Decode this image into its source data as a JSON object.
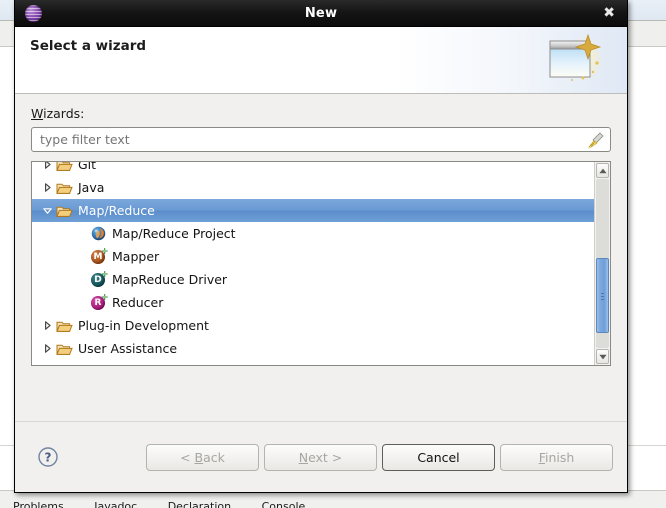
{
  "window": {
    "title": "New",
    "close_label": "✖",
    "app_icon": "eclipse-sphere-icon"
  },
  "header": {
    "title": "Select a wizard",
    "icon": "new-wizard-sparkle-icon"
  },
  "form": {
    "wizards_label_mnemonic": "W",
    "wizards_label_rest": "izards:",
    "filter_placeholder": "type filter text",
    "filter_value": "",
    "clear_filter_icon": "broom-clear-icon"
  },
  "tree": {
    "rows": [
      {
        "label": "Git",
        "level": 0,
        "expandable": true,
        "expanded": false,
        "selected": false,
        "icon": "folder-icon",
        "icon_kind": "folder"
      },
      {
        "label": "Java",
        "level": 0,
        "expandable": true,
        "expanded": false,
        "selected": false,
        "icon": "folder-icon",
        "icon_kind": "folder"
      },
      {
        "label": "Map/Reduce",
        "level": 0,
        "expandable": true,
        "expanded": true,
        "selected": true,
        "icon": "folder-icon",
        "icon_kind": "folder"
      },
      {
        "label": "Map/Reduce Project",
        "level": 1,
        "expandable": false,
        "expanded": false,
        "selected": false,
        "icon": "hadoop-elephant-icon",
        "icon_kind": "hadoop"
      },
      {
        "label": "Mapper",
        "level": 1,
        "expandable": false,
        "expanded": false,
        "selected": false,
        "icon": "mapper-m-icon",
        "icon_kind": "circle",
        "letter": "M",
        "color": "#a8521c"
      },
      {
        "label": "MapReduce Driver",
        "level": 1,
        "expandable": false,
        "expanded": false,
        "selected": false,
        "icon": "driver-d-icon",
        "icon_kind": "circle",
        "letter": "D",
        "color": "#12575c"
      },
      {
        "label": "Reducer",
        "level": 1,
        "expandable": false,
        "expanded": false,
        "selected": false,
        "icon": "reducer-r-icon",
        "icon_kind": "circle",
        "letter": "R",
        "color": "#a81c7c"
      },
      {
        "label": "Plug-in Development",
        "level": 0,
        "expandable": true,
        "expanded": false,
        "selected": false,
        "icon": "folder-icon",
        "icon_kind": "folder"
      },
      {
        "label": "User Assistance",
        "level": 0,
        "expandable": true,
        "expanded": false,
        "selected": false,
        "icon": "folder-icon",
        "icon_kind": "folder"
      }
    ],
    "scrollbar": {
      "up_arrow": "scroll-up-arrow-icon",
      "down_arrow": "scroll-down-arrow-icon",
      "thumb_top_pct": 47,
      "thumb_height_pct": 44
    }
  },
  "buttons": {
    "help_icon": "help-question-icon",
    "items": [
      {
        "label": "< Back",
        "mnemonic": "B",
        "enabled": false,
        "default": false,
        "name": "back-button"
      },
      {
        "label": "Next >",
        "mnemonic": "N",
        "enabled": false,
        "default": false,
        "name": "next-button"
      },
      {
        "label": "Cancel",
        "mnemonic": "",
        "enabled": true,
        "default": true,
        "name": "cancel-button"
      },
      {
        "label": "Finish",
        "mnemonic": "F",
        "enabled": false,
        "default": false,
        "name": "finish-button"
      }
    ]
  },
  "background": {
    "tabs": [
      {
        "label": "Problems",
        "icon": "problems-icon"
      },
      {
        "label": "Javadoc",
        "icon": "javadoc-icon"
      },
      {
        "label": "Declaration",
        "icon": "declaration-icon"
      },
      {
        "label": "Console",
        "icon": "console-icon"
      }
    ]
  },
  "colors": {
    "selection_blue": "#6a9ad4",
    "titlebar_black": "#161616",
    "dialog_gray": "#f1f0ee",
    "folder_orange": "#e8a33d"
  }
}
